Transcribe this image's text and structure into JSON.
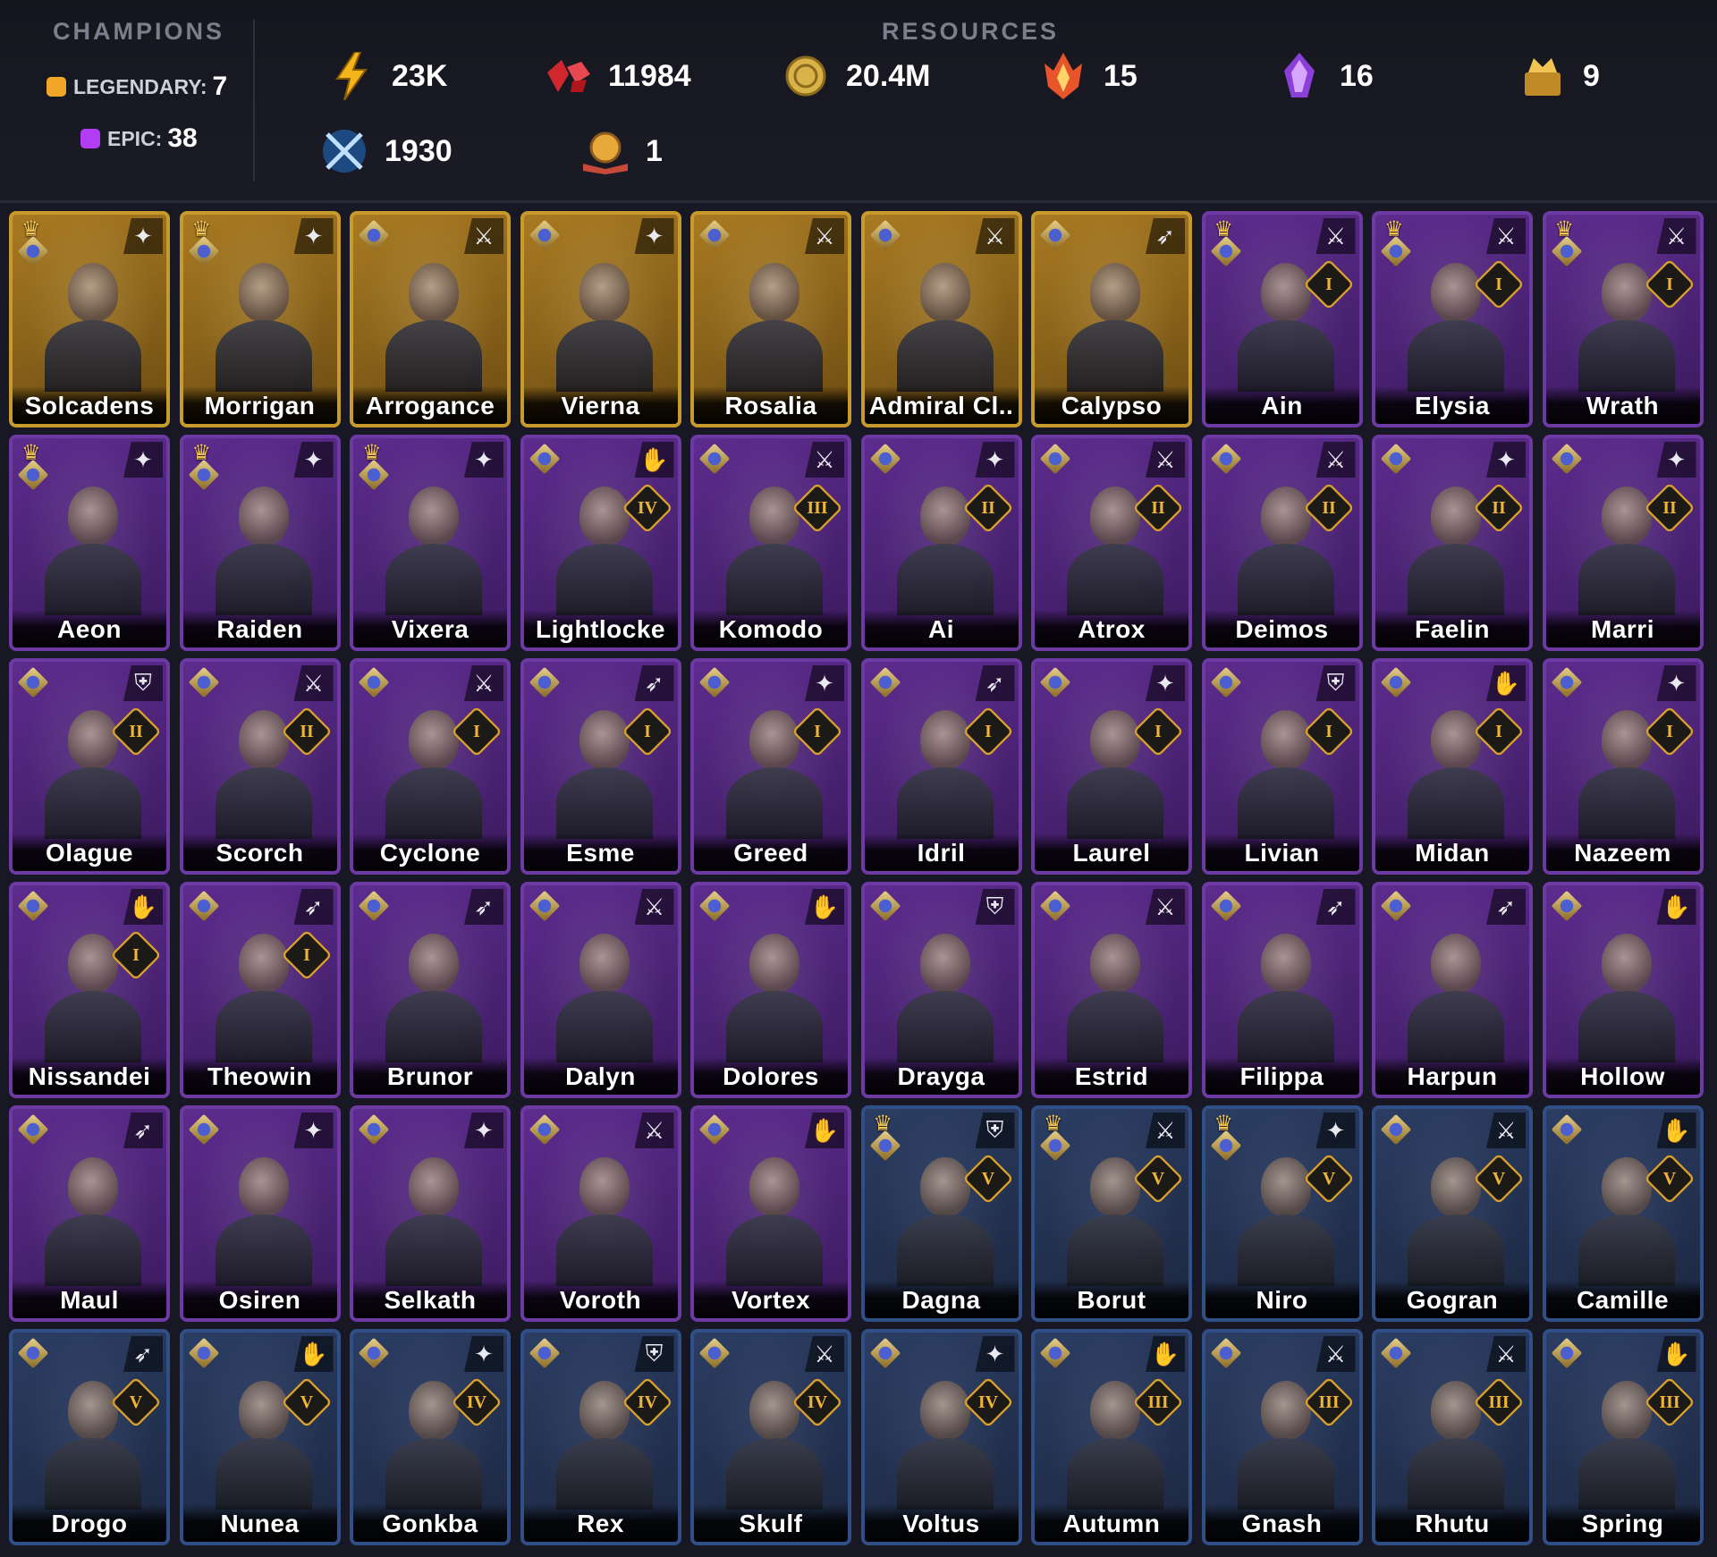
{
  "header": {
    "champions_title": "CHAMPIONS",
    "legendary": {
      "label": "LEGENDARY:",
      "value": "7",
      "color": "#f2a629"
    },
    "epic": {
      "label": "EPIC:",
      "value": "38",
      "color": "#b13cf2"
    },
    "resources_title": "RESOURCES",
    "resources": [
      {
        "icon": "energy-icon",
        "value": "23K"
      },
      {
        "icon": "gems-icon",
        "value": "11984"
      },
      {
        "icon": "silver-coin-icon",
        "value": "20.4M"
      },
      {
        "icon": "fire-shard-icon",
        "value": "15"
      },
      {
        "icon": "void-shard-icon",
        "value": "16"
      },
      {
        "icon": "relic-chest-icon",
        "value": "9"
      },
      {
        "icon": "arena-token-icon",
        "value": "1930"
      },
      {
        "icon": "book-icon",
        "value": "1"
      }
    ]
  },
  "champions": [
    {
      "name": "Solcadens",
      "rarity": "legendary",
      "crown": true,
      "role": "magic",
      "rank": ""
    },
    {
      "name": "Morrigan",
      "rarity": "legendary",
      "crown": true,
      "role": "magic",
      "rank": ""
    },
    {
      "name": "Arrogance",
      "rarity": "legendary",
      "crown": false,
      "role": "sword",
      "rank": ""
    },
    {
      "name": "Vierna",
      "rarity": "legendary",
      "crown": false,
      "role": "magic",
      "rank": ""
    },
    {
      "name": "Rosalia",
      "rarity": "legendary",
      "crown": false,
      "role": "sword",
      "rank": ""
    },
    {
      "name": "Admiral Cl..",
      "rarity": "legendary",
      "crown": false,
      "role": "sword",
      "rank": ""
    },
    {
      "name": "Calypso",
      "rarity": "legendary",
      "crown": false,
      "role": "bow",
      "rank": ""
    },
    {
      "name": "Ain",
      "rarity": "epic",
      "crown": true,
      "role": "sword",
      "rank": "I"
    },
    {
      "name": "Elysia",
      "rarity": "epic",
      "crown": true,
      "role": "sword",
      "rank": "I"
    },
    {
      "name": "Wrath",
      "rarity": "epic",
      "crown": true,
      "role": "sword",
      "rank": "I"
    },
    {
      "name": "Aeon",
      "rarity": "epic",
      "crown": true,
      "role": "magic",
      "rank": ""
    },
    {
      "name": "Raiden",
      "rarity": "epic",
      "crown": true,
      "role": "magic",
      "rank": ""
    },
    {
      "name": "Vixera",
      "rarity": "epic",
      "crown": true,
      "role": "magic",
      "rank": ""
    },
    {
      "name": "Lightlocke",
      "rarity": "epic",
      "crown": false,
      "role": "support",
      "rank": "IV"
    },
    {
      "name": "Komodo",
      "rarity": "epic",
      "crown": false,
      "role": "sword",
      "rank": "III"
    },
    {
      "name": "Ai",
      "rarity": "epic",
      "crown": false,
      "role": "magic",
      "rank": "II"
    },
    {
      "name": "Atrox",
      "rarity": "epic",
      "crown": false,
      "role": "sword",
      "rank": "II"
    },
    {
      "name": "Deimos",
      "rarity": "epic",
      "crown": false,
      "role": "sword",
      "rank": "II"
    },
    {
      "name": "Faelin",
      "rarity": "epic",
      "crown": false,
      "role": "magic",
      "rank": "II"
    },
    {
      "name": "Marri",
      "rarity": "epic",
      "crown": false,
      "role": "magic",
      "rank": "II"
    },
    {
      "name": "Olague",
      "rarity": "epic",
      "crown": false,
      "role": "shield",
      "rank": "II"
    },
    {
      "name": "Scorch",
      "rarity": "epic",
      "crown": false,
      "role": "sword",
      "rank": "II"
    },
    {
      "name": "Cyclone",
      "rarity": "epic",
      "crown": false,
      "role": "sword",
      "rank": "I"
    },
    {
      "name": "Esme",
      "rarity": "epic",
      "crown": false,
      "role": "bow",
      "rank": "I"
    },
    {
      "name": "Greed",
      "rarity": "epic",
      "crown": false,
      "role": "magic",
      "rank": "I"
    },
    {
      "name": "Idril",
      "rarity": "epic",
      "crown": false,
      "role": "bow",
      "rank": "I"
    },
    {
      "name": "Laurel",
      "rarity": "epic",
      "crown": false,
      "role": "magic",
      "rank": "I"
    },
    {
      "name": "Livian",
      "rarity": "epic",
      "crown": false,
      "role": "shield",
      "rank": "I"
    },
    {
      "name": "Midan",
      "rarity": "epic",
      "crown": false,
      "role": "support",
      "rank": "I"
    },
    {
      "name": "Nazeem",
      "rarity": "epic",
      "crown": false,
      "role": "magic",
      "rank": "I"
    },
    {
      "name": "Nissandei",
      "rarity": "epic",
      "crown": false,
      "role": "support",
      "rank": "I"
    },
    {
      "name": "Theowin",
      "rarity": "epic",
      "crown": false,
      "role": "bow",
      "rank": "I"
    },
    {
      "name": "Brunor",
      "rarity": "epic",
      "crown": false,
      "role": "bow",
      "rank": ""
    },
    {
      "name": "Dalyn",
      "rarity": "epic",
      "crown": false,
      "role": "sword",
      "rank": ""
    },
    {
      "name": "Dolores",
      "rarity": "epic",
      "crown": false,
      "role": "support",
      "rank": ""
    },
    {
      "name": "Drayga",
      "rarity": "epic",
      "crown": false,
      "role": "shield",
      "rank": ""
    },
    {
      "name": "Estrid",
      "rarity": "epic",
      "crown": false,
      "role": "sword",
      "rank": ""
    },
    {
      "name": "Filippa",
      "rarity": "epic",
      "crown": false,
      "role": "bow",
      "rank": ""
    },
    {
      "name": "Harpun",
      "rarity": "epic",
      "crown": false,
      "role": "bow",
      "rank": ""
    },
    {
      "name": "Hollow",
      "rarity": "epic",
      "crown": false,
      "role": "support",
      "rank": ""
    },
    {
      "name": "Maul",
      "rarity": "epic",
      "crown": false,
      "role": "bow",
      "rank": ""
    },
    {
      "name": "Osiren",
      "rarity": "epic",
      "crown": false,
      "role": "magic",
      "rank": ""
    },
    {
      "name": "Selkath",
      "rarity": "epic",
      "crown": false,
      "role": "magic",
      "rank": ""
    },
    {
      "name": "Voroth",
      "rarity": "epic",
      "crown": false,
      "role": "sword",
      "rank": ""
    },
    {
      "name": "Vortex",
      "rarity": "epic",
      "crown": false,
      "role": "support",
      "rank": ""
    },
    {
      "name": "Dagna",
      "rarity": "rare",
      "crown": true,
      "role": "shield",
      "rank": "V"
    },
    {
      "name": "Borut",
      "rarity": "rare",
      "crown": true,
      "role": "sword",
      "rank": "V"
    },
    {
      "name": "Niro",
      "rarity": "rare",
      "crown": true,
      "role": "magic",
      "rank": "V"
    },
    {
      "name": "Gogran",
      "rarity": "rare",
      "crown": false,
      "role": "sword",
      "rank": "V"
    },
    {
      "name": "Camille",
      "rarity": "rare",
      "crown": false,
      "role": "support",
      "rank": "V"
    },
    {
      "name": "Drogo",
      "rarity": "rare",
      "crown": false,
      "role": "bow",
      "rank": "V"
    },
    {
      "name": "Nunea",
      "rarity": "rare",
      "crown": false,
      "role": "support",
      "rank": "V"
    },
    {
      "name": "Gonkba",
      "rarity": "rare",
      "crown": false,
      "role": "magic",
      "rank": "IV"
    },
    {
      "name": "Rex",
      "rarity": "rare",
      "crown": false,
      "role": "shield",
      "rank": "IV"
    },
    {
      "name": "Skulf",
      "rarity": "rare",
      "crown": false,
      "role": "sword",
      "rank": "IV"
    },
    {
      "name": "Voltus",
      "rarity": "rare",
      "crown": false,
      "role": "magic",
      "rank": "IV"
    },
    {
      "name": "Autumn",
      "rarity": "rare",
      "crown": false,
      "role": "support",
      "rank": "III"
    },
    {
      "name": "Gnash",
      "rarity": "rare",
      "crown": false,
      "role": "sword",
      "rank": "III"
    },
    {
      "name": "Rhutu",
      "rarity": "rare",
      "crown": false,
      "role": "sword",
      "rank": "III"
    },
    {
      "name": "Spring",
      "rarity": "rare",
      "crown": false,
      "role": "support",
      "rank": "III"
    }
  ]
}
